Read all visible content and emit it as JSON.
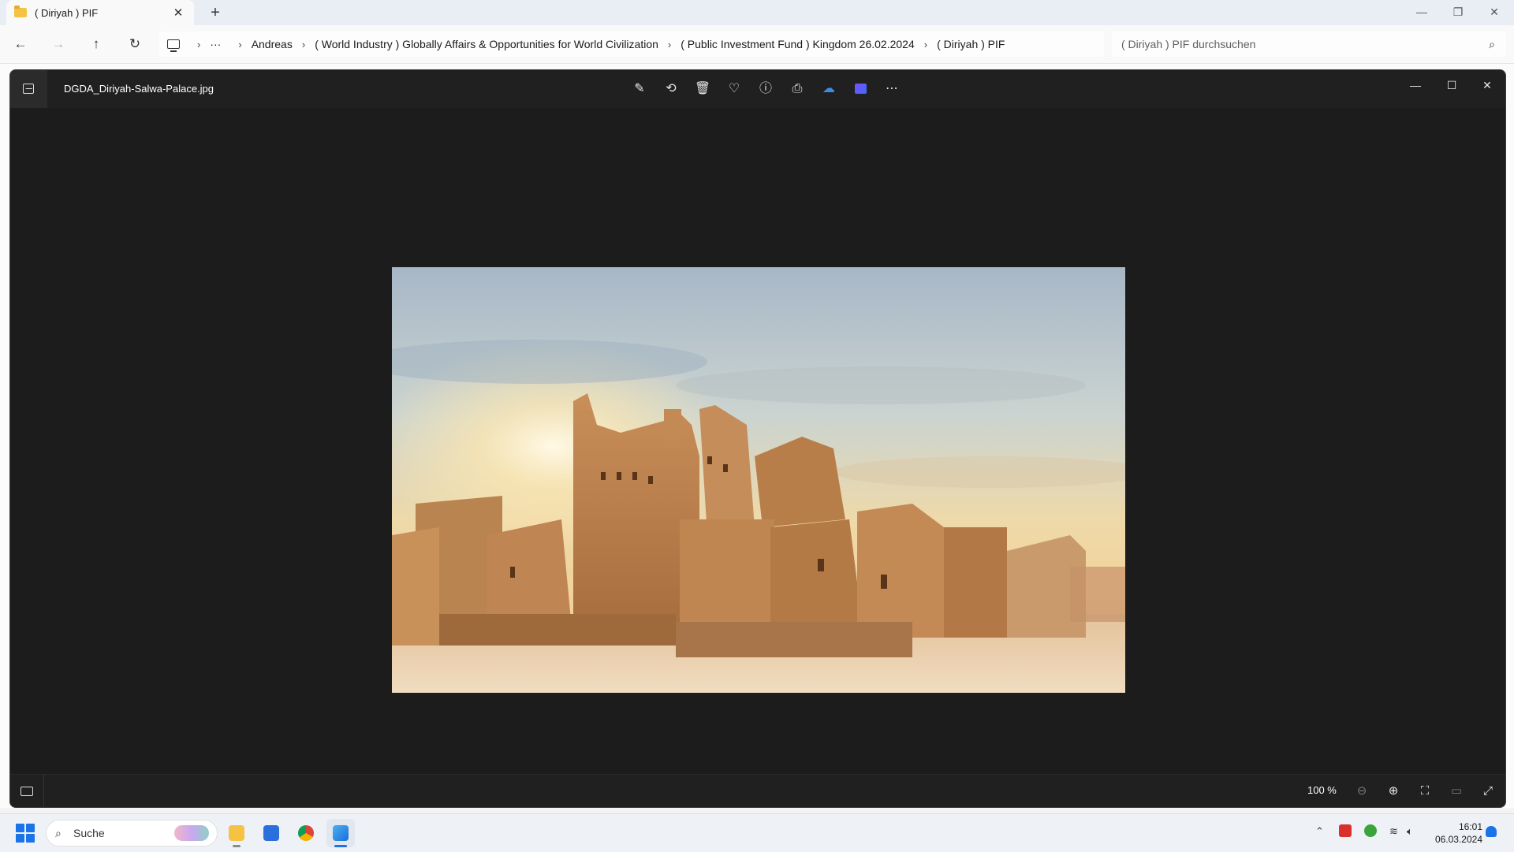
{
  "explorer": {
    "tab_title": "( Diriyah ) PIF",
    "new_tab": "+",
    "breadcrumb_overflow": "···",
    "breadcrumbs": [
      "Andreas",
      "( World Industry ) Globally Affairs & Opportunities for World Civilization",
      "( Public Investment Fund ) Kingdom 26.02.2024",
      "( Diriyah ) PIF"
    ],
    "search_placeholder": "( Diriyah ) PIF durchsuchen"
  },
  "viewer": {
    "file_name": "DGDA_Diriyah-Salwa-Palace.jpg",
    "toolbar": [
      "edit-icon",
      "rotate-icon",
      "delete-icon",
      "favorite-icon",
      "info-icon",
      "print-icon",
      "onedrive-icon",
      "clipchamp-icon",
      "more-icon"
    ],
    "zoom": "100 %",
    "colors": {
      "background": "#202020",
      "accent": "#1a73e8"
    }
  },
  "taskbar": {
    "search_label": "Suche",
    "time": "16:01",
    "date": "06.03.2024"
  }
}
